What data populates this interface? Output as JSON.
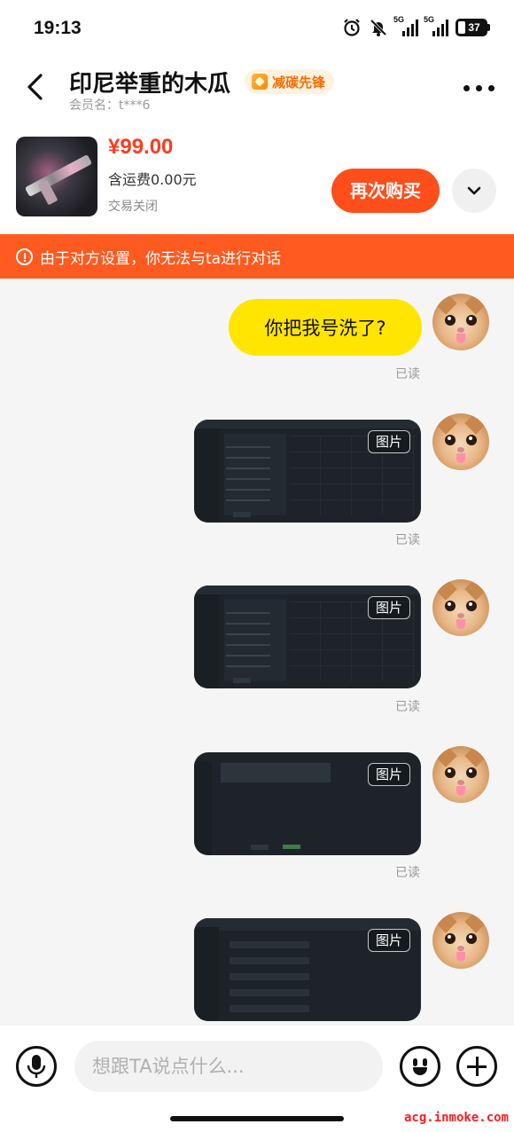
{
  "status_bar": {
    "time": "19:13",
    "signal1_label": "5G",
    "signal2_label": "5G",
    "battery": "37"
  },
  "header": {
    "title": "印尼举重的木瓜",
    "badge": "减碳先锋",
    "member": "会员名：t***6"
  },
  "product": {
    "price": "¥99.00",
    "shipping": "含运费0.00元",
    "status": "交易关闭",
    "buy_again_label": "再次购买"
  },
  "warning": {
    "text": "由于对方设置，你无法与ta进行对话"
  },
  "messages": [
    {
      "type": "text",
      "text": "你把我号洗了?",
      "read": "已读"
    },
    {
      "type": "image",
      "tag": "图片",
      "read": "已读"
    },
    {
      "type": "image",
      "tag": "图片",
      "read": "已读"
    },
    {
      "type": "image",
      "tag": "图片",
      "read": "已读"
    },
    {
      "type": "image",
      "tag": "图片"
    }
  ],
  "input_bar": {
    "placeholder": "想跟TA说点什么..."
  },
  "watermark": "acg.inmoke.com",
  "colors": {
    "accent": "#ff4e1a",
    "warning_bg": "#ff5a1f",
    "price": "#ff3b1f",
    "bubble": "#ffe500"
  },
  "icons": {
    "back": "back-arrow-icon",
    "more": "more-dots-icon",
    "expand": "chevron-down-icon",
    "warning": "info-icon",
    "mic": "microphone-icon",
    "emoji": "emoji-icon",
    "plus": "plus-icon"
  }
}
